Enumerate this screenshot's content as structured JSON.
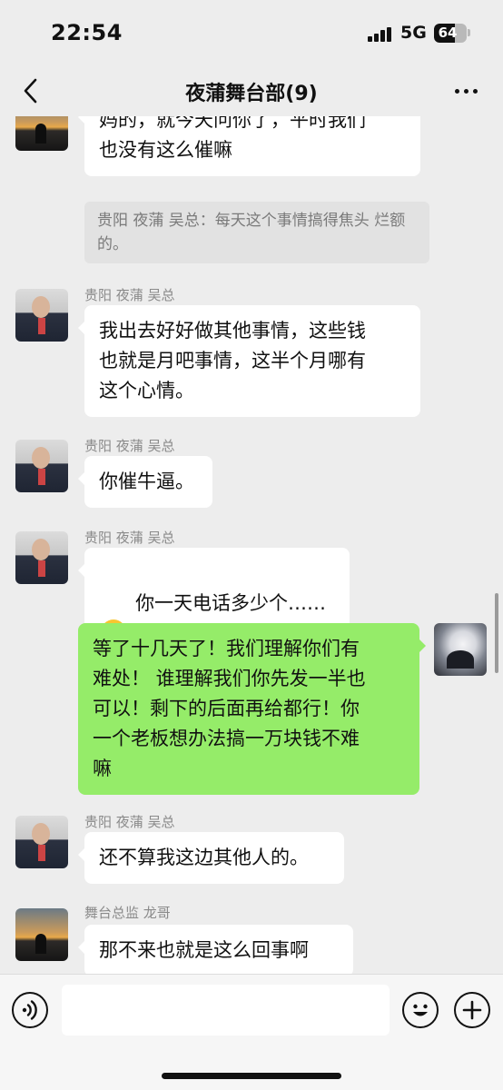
{
  "status_bar": {
    "time": "22:54",
    "network": "5G",
    "battery": "64",
    "battery_level": 0.64
  },
  "header": {
    "title": "夜蒲舞台部(9)"
  },
  "messages": [
    {
      "sender": "",
      "text": "妈的，就今天问你了，平时我们\n也没有这么催嘛",
      "quote": "贵阳 夜蒲 吴总：每天这个事情搞得焦头\n烂额的。"
    },
    {
      "sender": "贵阳 夜蒲 吴总",
      "text": "我出去好好做其他事情，这些钱\n也就是月吧事情，这半个月哪有\n这个心情。"
    },
    {
      "sender": "贵阳 夜蒲 吴总",
      "text": "你催牛逼。"
    },
    {
      "sender": "贵阳 夜蒲 吴总",
      "text": "你一天电话多少个……",
      "emoji": "flushed-face-emoji"
    },
    {
      "sender": "",
      "text": "等了十几天了！我们理解你们有\n难处！ 谁理解我们你先发一半也\n可以！剩下的后面再给都行！你\n一个老板想办法搞一万块钱不难\n嘛"
    },
    {
      "sender": "贵阳 夜蒲 吴总",
      "text": "还不算我这边其他人的。"
    },
    {
      "sender": "舞台总监 龙哥",
      "text": "那不来也就是这么回事啊"
    }
  ],
  "input": {
    "placeholder": ""
  },
  "icons": {
    "back": "chevron-left-icon",
    "more": "more-dots-icon",
    "voice": "voice-icon",
    "emoji": "emoji-icon",
    "plus": "plus-icon"
  },
  "colors": {
    "background": "#ededed",
    "incoming_bubble": "#ffffff",
    "outgoing_bubble": "#95ec69"
  }
}
